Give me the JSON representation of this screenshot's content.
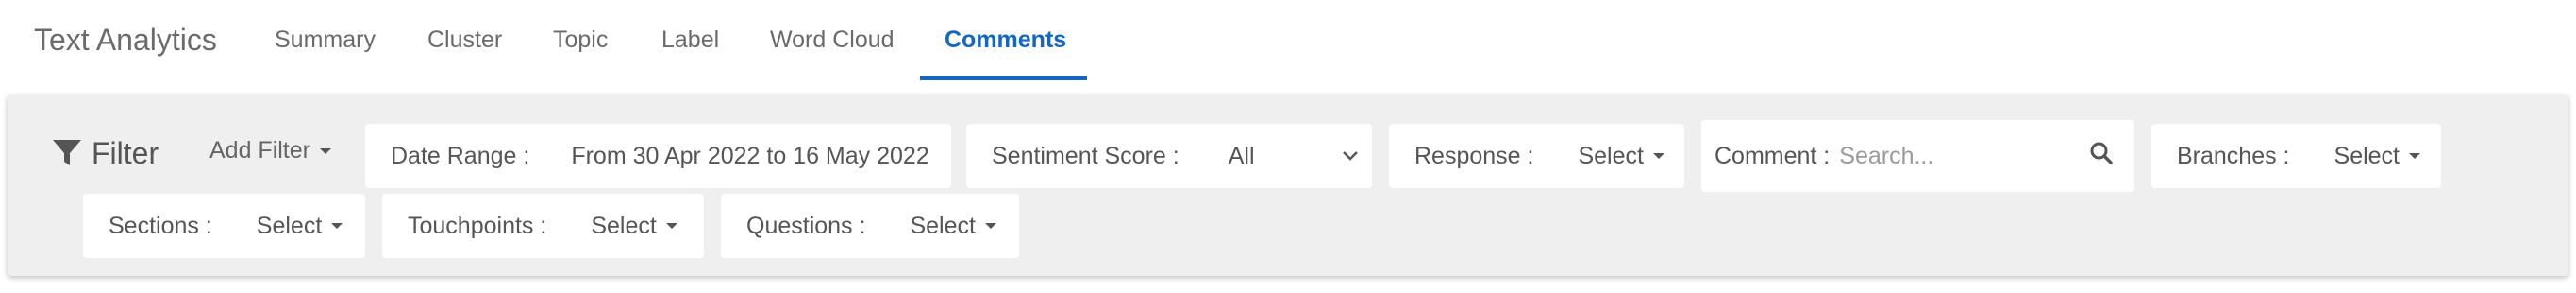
{
  "header": {
    "app_title": "Text Analytics",
    "tabs": [
      {
        "label": "Summary",
        "active": false
      },
      {
        "label": "Cluster",
        "active": false
      },
      {
        "label": "Topic",
        "active": false
      },
      {
        "label": "Label",
        "active": false
      },
      {
        "label": "Word Cloud",
        "active": false
      },
      {
        "label": "Comments",
        "active": true
      }
    ]
  },
  "filter": {
    "title": "Filter",
    "add_filter_label": "Add Filter",
    "date_range": {
      "label": "Date Range :",
      "value": "From 30 Apr 2022 to 16 May 2022"
    },
    "sentiment_score": {
      "label": "Sentiment Score :",
      "value": "All"
    },
    "response": {
      "label": "Response :",
      "value": "Select"
    },
    "comment": {
      "label": "Comment :",
      "placeholder": "Search..."
    },
    "branches": {
      "label": "Branches :",
      "value": "Select"
    },
    "sections": {
      "label": "Sections :",
      "value": "Select"
    },
    "touchpoints": {
      "label": "Touchpoints :",
      "value": "Select"
    },
    "questions": {
      "label": "Questions :",
      "value": "Select"
    }
  },
  "colors": {
    "accent": "#1466c3",
    "panel_background": "#efefef",
    "box_background": "#ffffff"
  },
  "icons": {
    "filter": "filter-funnel-icon",
    "search": "search-icon",
    "dropdown": "caret-down-icon",
    "select_chevron": "chevron-down-icon"
  }
}
